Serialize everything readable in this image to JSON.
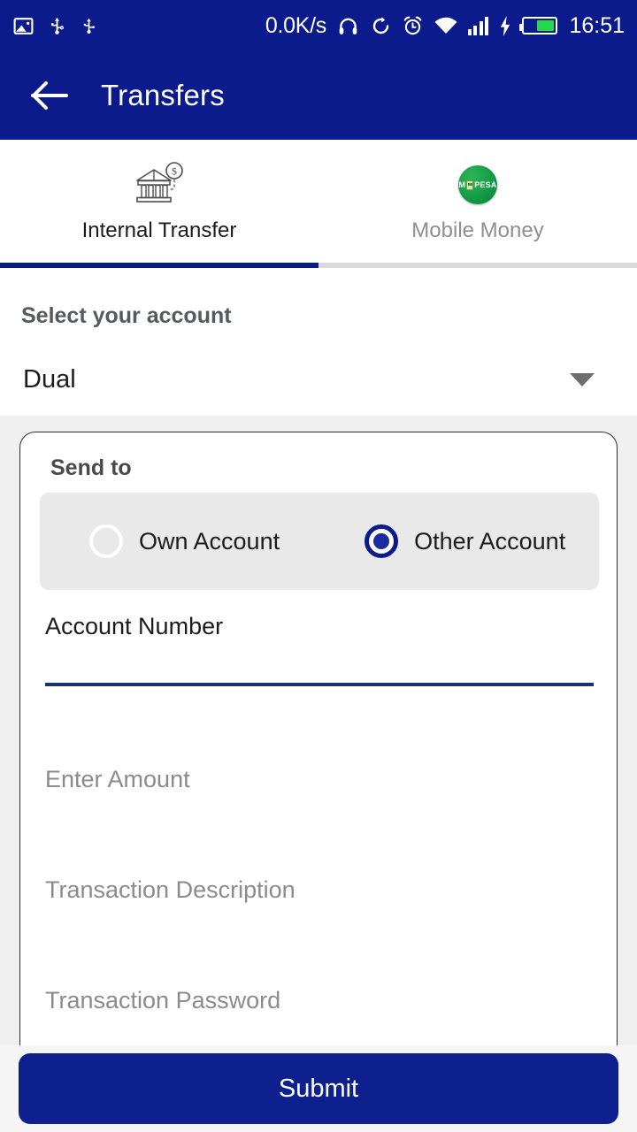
{
  "status_bar": {
    "network_speed": "0.0K/s",
    "clock": "16:51",
    "icons": [
      "image-icon",
      "usb-debug-icon",
      "usb-icon",
      "headphones-icon",
      "sync-rotate-icon",
      "alarm-clock-icon",
      "wifi-icon",
      "signal-bars-icon",
      "charging-bolt-icon",
      "battery-icon"
    ],
    "battery_color": "#25d94b",
    "background": "#0b1b8c"
  },
  "app_bar": {
    "title": "Transfers",
    "back_icon": "arrow-left-icon",
    "background": "#0b1b8c"
  },
  "tabs": {
    "active_index": 0,
    "indicator_color": "#0b1b8c",
    "items": [
      {
        "label": "Internal Transfer",
        "icon": "bank-dollar-icon",
        "active": true
      },
      {
        "label": "Mobile Money",
        "icon": "mpesa-logo-icon",
        "active": false
      }
    ],
    "mpesa_logo": {
      "m": "M",
      "pesa": "PESA",
      "color": "#149b45"
    }
  },
  "account_select": {
    "label": "Select your account",
    "value": "Dual",
    "caret_icon": "chevron-down-icon"
  },
  "send_to_card": {
    "title": "Send to",
    "radio_group": {
      "selected": "Other Account",
      "options": [
        {
          "label": "Own Account",
          "selected": false
        },
        {
          "label": "Other Account",
          "selected": true
        }
      ],
      "background": "#e9e9e9",
      "accent": "#0b1b8c"
    },
    "fields": [
      {
        "label": "Account Number",
        "value": "",
        "focused": true,
        "underline_color": "#19307d"
      },
      {
        "label": "Enter Amount",
        "value": "",
        "focused": false
      },
      {
        "label": "Transaction Description",
        "value": "",
        "focused": false
      },
      {
        "label": "Transaction Password",
        "value": "",
        "focused": false
      }
    ]
  },
  "submit": {
    "label": "Submit",
    "color": "#0d208e"
  }
}
